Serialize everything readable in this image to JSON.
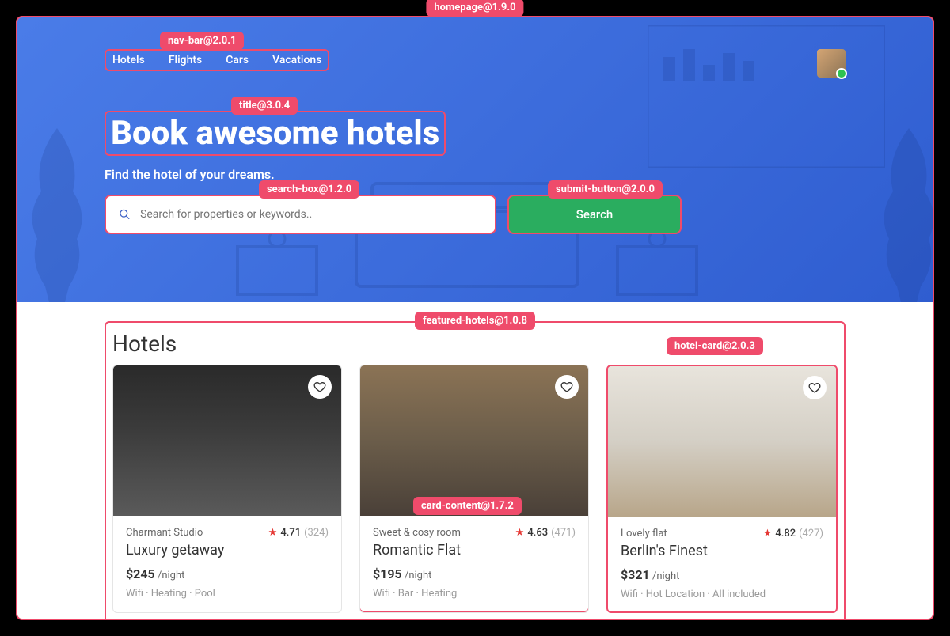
{
  "annotations": {
    "homepage": "homepage@1.9.0",
    "navbar": "nav-bar@2.0.1",
    "title": "title@3.0.4",
    "searchbox": "search-box@1.2.0",
    "submitbtn": "submit-button@2.0.0",
    "featured": "featured-hotels@1.0.8",
    "hotelcard": "hotel-card@2.0.3",
    "cardcontent": "card-content@1.7.2"
  },
  "nav": {
    "items": [
      "Hotels",
      "Flights",
      "Cars",
      "Vacations"
    ]
  },
  "hero": {
    "title": "Book awesome hotels",
    "subtitle": "Find the hotel of your dreams.",
    "search_placeholder": "Search for properties or keywords..",
    "search_button": "Search"
  },
  "section": {
    "title": "Hotels"
  },
  "hotels": [
    {
      "eyebrow": "Charmant Studio",
      "rating": "4.71",
      "count": "(324)",
      "title": "Luxury getaway",
      "price": "$245",
      "per": "/night",
      "amenities": "Wifi · Heating · Pool"
    },
    {
      "eyebrow": "Sweet & cosy room",
      "rating": "4.63",
      "count": "(471)",
      "title": "Romantic Flat",
      "price": "$195",
      "per": "/night",
      "amenities": "Wifi · Bar · Heating"
    },
    {
      "eyebrow": "Lovely flat",
      "rating": "4.82",
      "count": "(427)",
      "title": "Berlin's Finest",
      "price": "$321",
      "per": "/night",
      "amenities": "Wifi · Hot Location · All included"
    }
  ]
}
